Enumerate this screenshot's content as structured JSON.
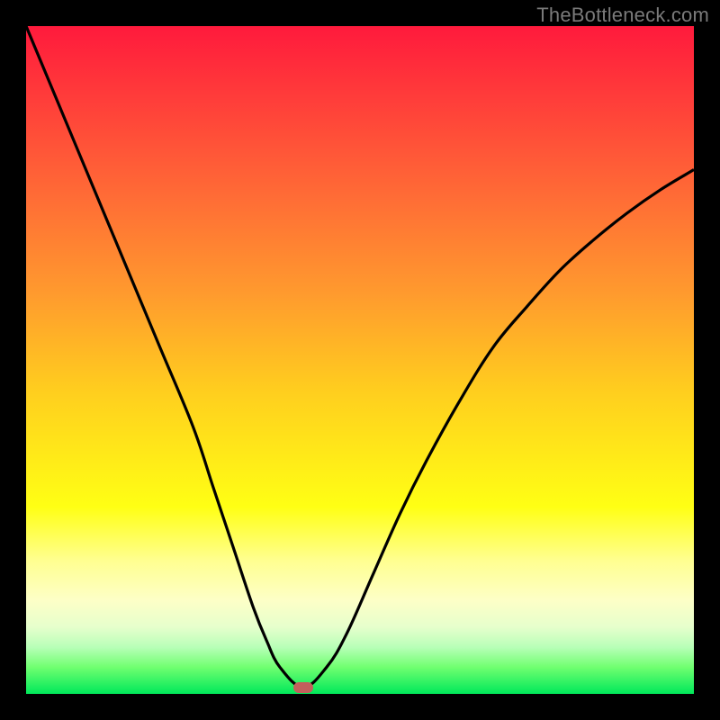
{
  "watermark": "TheBottleneck.com",
  "colors": {
    "curve_stroke": "#000000",
    "marker_fill": "#c2605c"
  },
  "chart_data": {
    "type": "line",
    "title": "",
    "xlabel": "",
    "ylabel": "",
    "xlim": [
      0,
      100
    ],
    "ylim": [
      0,
      100
    ],
    "grid": false,
    "series": [
      {
        "name": "bottleneck-curve",
        "x": [
          0,
          5,
          10,
          15,
          20,
          25,
          28,
          31,
          34,
          36,
          38,
          41.5,
          45,
          48,
          52,
          56,
          60,
          65,
          70,
          75,
          80,
          85,
          90,
          95,
          100
        ],
        "values": [
          100,
          88,
          76,
          64,
          52,
          40,
          31,
          22,
          13,
          8,
          4,
          1,
          4,
          9,
          18,
          27,
          35,
          44,
          52,
          58,
          63.5,
          68,
          72,
          75.5,
          78.5
        ]
      }
    ],
    "marker": {
      "x": 41.5,
      "y": 1
    }
  }
}
